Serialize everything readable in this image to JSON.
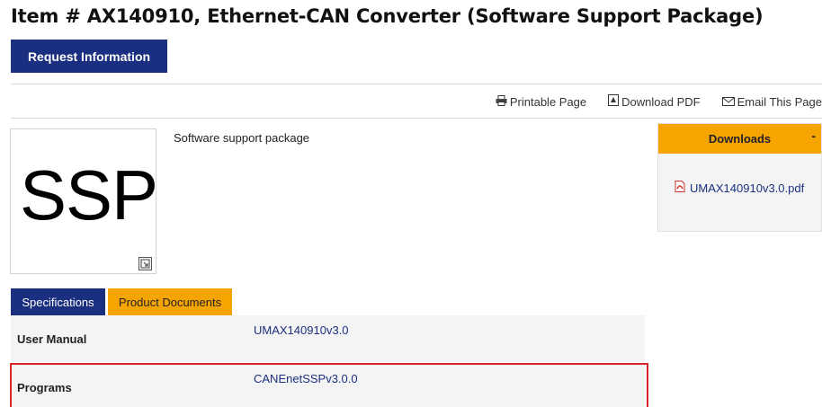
{
  "page": {
    "title": "Item # AX140910, Ethernet-CAN Converter (Software Support Package)"
  },
  "actions": {
    "request_label": "Request Information"
  },
  "toolbar": {
    "printable": "Printable Page",
    "download_pdf": "Download PDF",
    "email": "Email This Page"
  },
  "product": {
    "image_text": "SSP",
    "description": "Software support package"
  },
  "downloads": {
    "heading": "Downloads",
    "collapse_symbol": "-",
    "file": "UMAX140910v3.0.pdf"
  },
  "tabs": {
    "specifications": "Specifications",
    "product_documents": "Product Documents"
  },
  "documents": [
    {
      "label": "User Manual",
      "link": "UMAX140910v3.0"
    },
    {
      "label": "Programs",
      "link": "CANEnetSSPv3.0.0"
    }
  ],
  "colors": {
    "brand_blue": "#1b2f80",
    "accent_orange": "#f5a400",
    "highlight_red": "#d9262c"
  }
}
